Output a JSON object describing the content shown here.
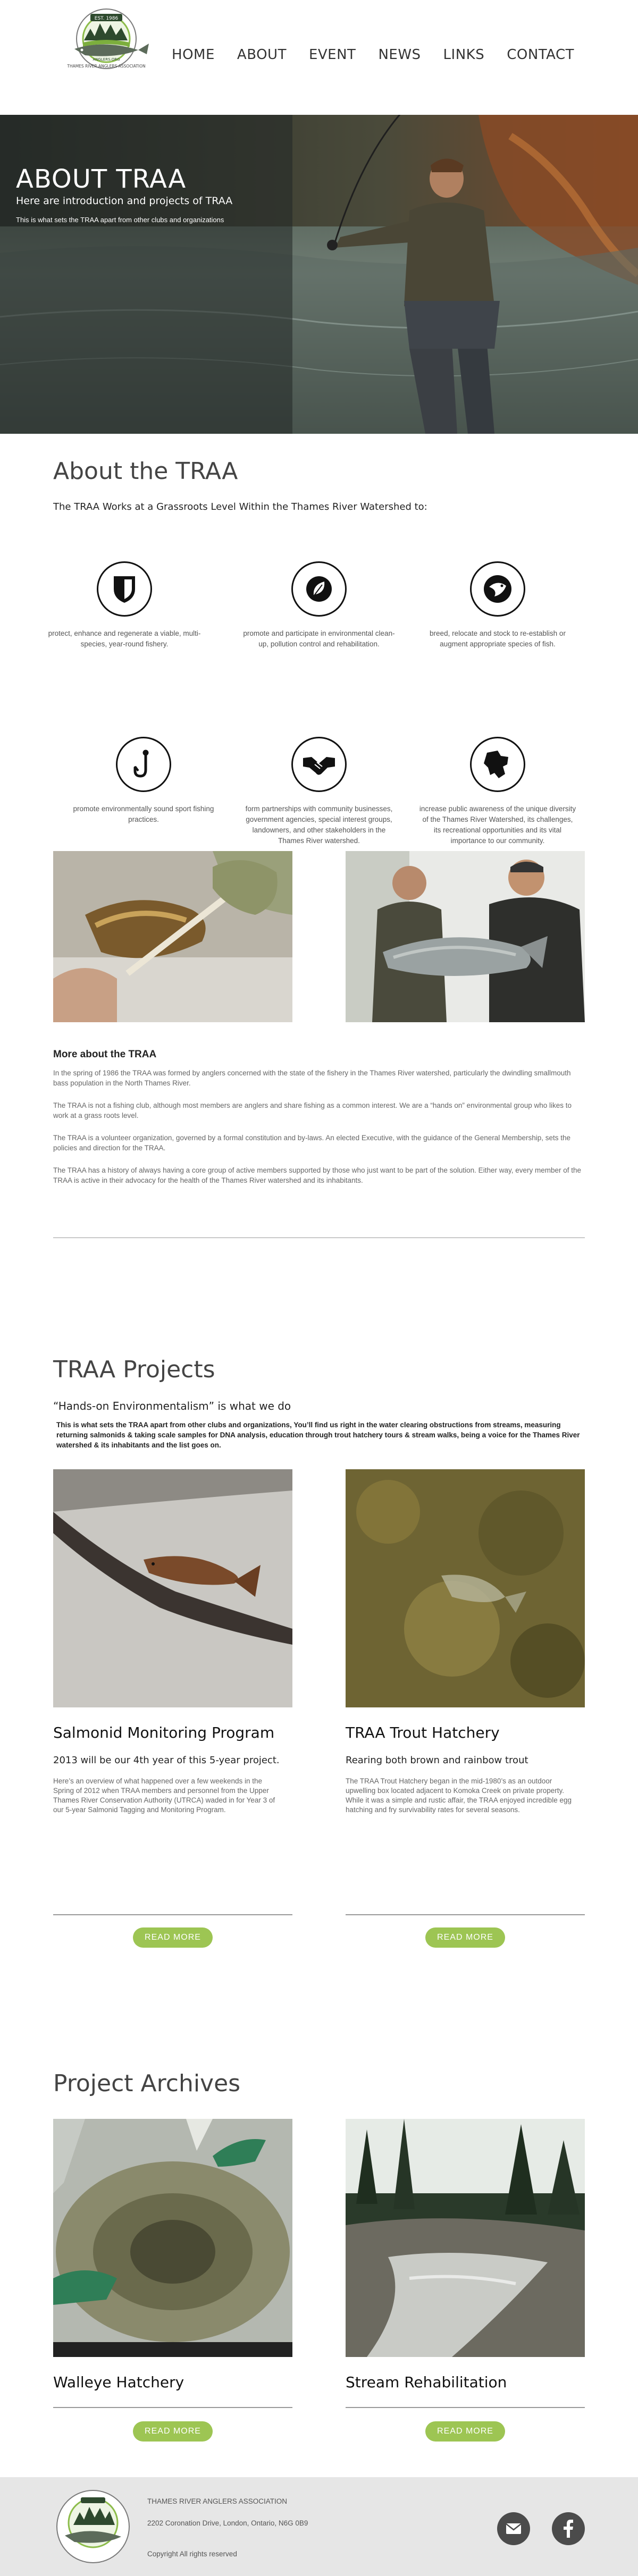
{
  "brand": {
    "logo_year": "EST. 1986",
    "logo_name": "THAMES RIVER ANGLERS ASSOCIATION",
    "logo_sub": "ANGLERS.ORG"
  },
  "nav": [
    "HOME",
    "ABOUT",
    "EVENT",
    "NEWS",
    "LINKS",
    "CONTACT"
  ],
  "hero": {
    "title": "ABOUT TRAA",
    "subtitle": "Here are introduction and projects of TRAA",
    "tagline": "This is what sets the TRAA apart from other clubs and organizations"
  },
  "about": {
    "title": "About the TRAA",
    "lead": "The TRAA Works at a Grassroots Level Within the Thames River Watershed to:",
    "features": [
      {
        "icon": "shield-icon",
        "text": "protect, enhance and regenerate a viable, multi-species, year-round fishery."
      },
      {
        "icon": "leaf-icon",
        "text": "promote and participate in environmental clean-up, pollution control and rehabilitation."
      },
      {
        "icon": "fish-icon",
        "text": "breed, relocate and stock to re-establish or augment appropriate species of fish."
      },
      {
        "icon": "fishhook-icon",
        "text": "promote environmentally sound sport fishing practices."
      },
      {
        "icon": "handshake-icon",
        "text": "form partnerships with community businesses, government agencies, special interest groups, landowners, and other stakeholders in the Thames River watershed."
      },
      {
        "icon": "ontario-map-icon",
        "text": "increase public awareness of the unique diversity of the Thames River Watershed, its challenges, its recreational opportunities and its vital importance to our community."
      }
    ],
    "more_title": "More about the TRAA",
    "paragraphs": [
      "In the spring of 1986 the TRAA was formed by anglers concerned with the state of the fishery in the Thames River watershed, particularly the dwindling smallmouth bass population in the North Thames River.",
      "The TRAA is not a fishing club, although most members are anglers and share fishing as a common interest. We are a “hands on” environmental group who likes to work at a grass roots level.",
      "The TRAA is a volunteer organization, governed by a formal constitution and by-laws. An elected Executive, with the guidance of the General Membership, sets the policies and direction for the TRAA.",
      "The TRAA has a history of always having a core group of active members supported by those who just want to be part of the solution. Either way, every member of the TRAA is active in their advocacy for the health of the Thames River watershed and its inhabitants."
    ]
  },
  "projects": {
    "title": "TRAA Projects",
    "lead": "“Hands-on Environmentalism” is what we do",
    "description": "This is what sets the TRAA apart from other clubs and organizations, You’ll find us right in the water clearing obstructions from streams, measuring returning salmonids & taking scale samples for DNA analysis, education through trout hatchery tours & stream walks, being a voice for the Thames River watershed & its inhabitants and the list goes on.",
    "items": [
      {
        "title": "Salmonid Monitoring Program",
        "subtitle": "2013 will be our 4th year of this 5-year project.",
        "text": "Here’s an overview of what happened over a few weekends in the Spring of 2012 when TRAA members and personnel from the Upper Thames River Conservation Authority (UTRCA) waded in for Year 3 of our 5-year Salmonid Tagging and Monitoring Program.",
        "button": "READ MORE"
      },
      {
        "title": "TRAA Trout Hatchery",
        "subtitle": "Rearing both brown and rainbow trout",
        "text": "The TRAA Trout Hatchery began in the mid-1980’s as an outdoor upwelling box located adjacent to Komoka Creek on private property. While it was a simple and rustic affair, the TRAA enjoyed incredible egg hatching and fry survivability rates for several seasons.",
        "button": "READ MORE"
      }
    ]
  },
  "archives": {
    "title": "Project Archives",
    "items": [
      {
        "title": "Walleye Hatchery",
        "button": "READ MORE"
      },
      {
        "title": "Stream Rehabilitation",
        "button": "READ MORE"
      }
    ]
  },
  "footer": {
    "org": "THAMES RIVER ANGLERS ASSOCIATION",
    "address": "2202 Coronation Drive, London, Ontario, N6G 0B9",
    "copyright": "Copyright All rights reserved"
  }
}
